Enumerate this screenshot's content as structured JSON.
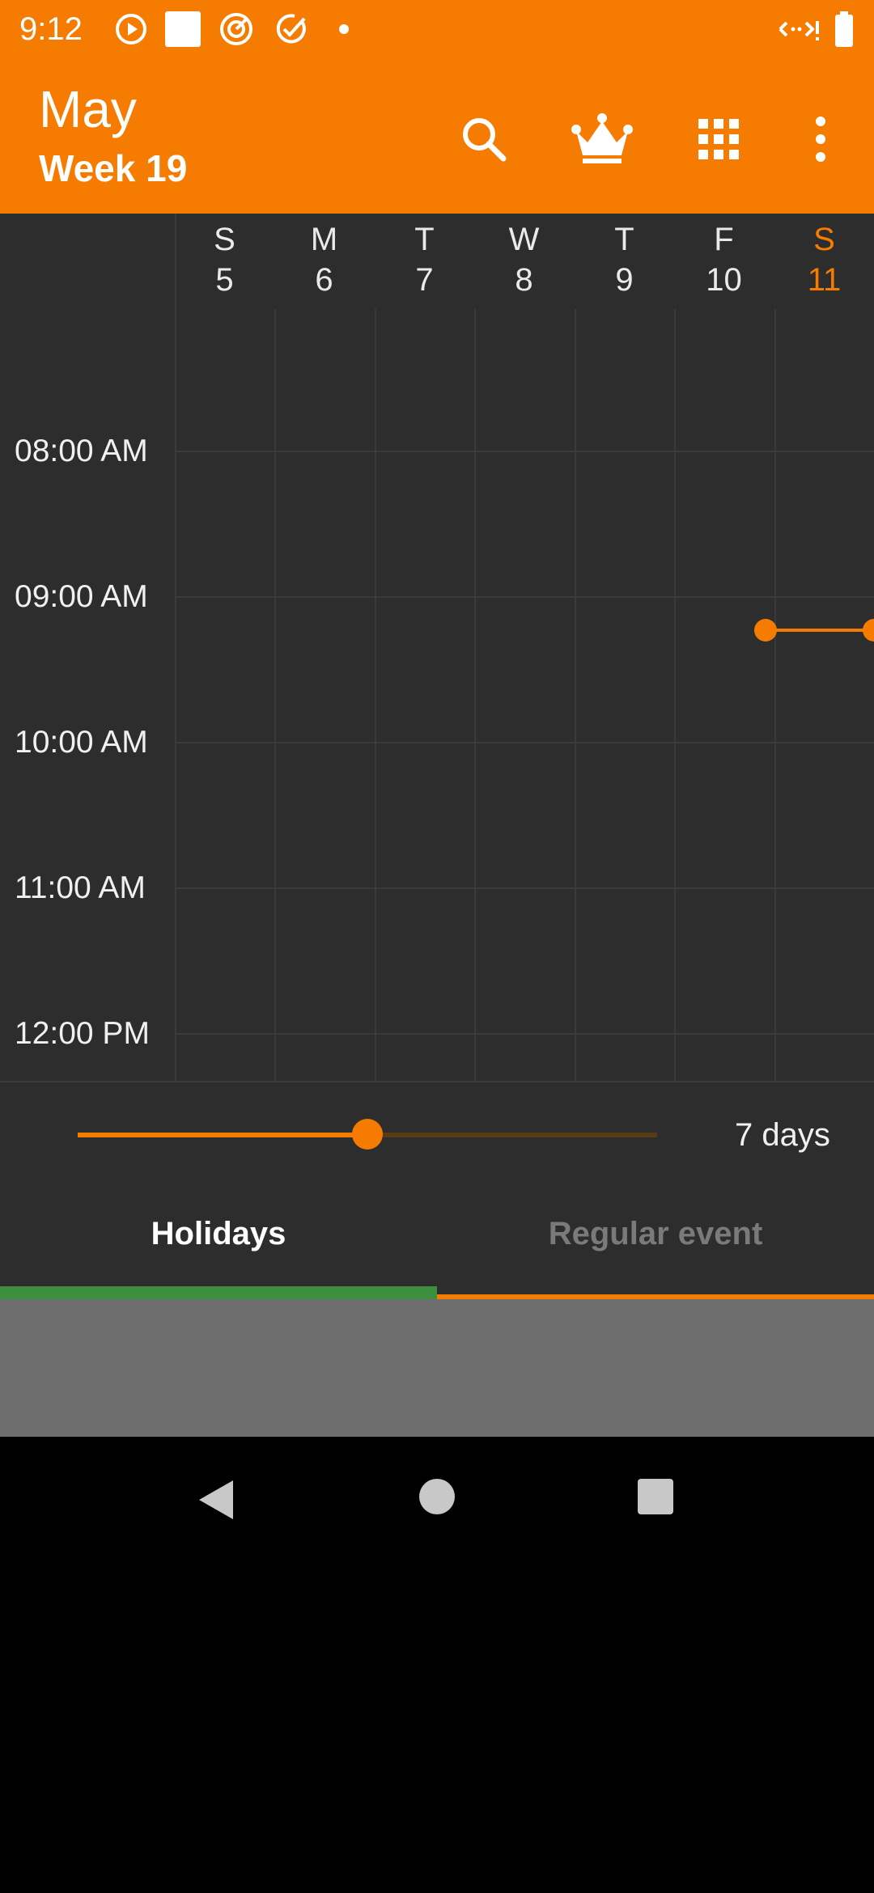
{
  "status_bar": {
    "time": "9:12",
    "icons": [
      "play-circle-icon",
      "square-notification-icon",
      "target-icon",
      "check-badge-icon",
      "dot-icon",
      "data-saver-icon",
      "battery-icon"
    ]
  },
  "app_bar": {
    "title": "May",
    "subtitle": "Week 19",
    "actions": [
      "search-icon",
      "crown-icon",
      "grid-apps-icon",
      "more-vert-icon"
    ]
  },
  "week": {
    "days": [
      {
        "letter": "S",
        "number": "5",
        "today": false
      },
      {
        "letter": "M",
        "number": "6",
        "today": false
      },
      {
        "letter": "T",
        "number": "7",
        "today": false
      },
      {
        "letter": "W",
        "number": "8",
        "today": false
      },
      {
        "letter": "T",
        "number": "9",
        "today": false
      },
      {
        "letter": "F",
        "number": "10",
        "today": false
      },
      {
        "letter": "S",
        "number": "11",
        "today": true
      }
    ]
  },
  "time_labels": [
    "08:00 AM",
    "09:00 AM",
    "10:00 AM",
    "11:00 AM",
    "12:00 PM"
  ],
  "controls": {
    "days_value": "7 days",
    "slider_fraction": 0.5
  },
  "tabs": {
    "holidays": "Holidays",
    "regular": "Regular event"
  },
  "colors": {
    "accent": "#F57C00",
    "background": "#2D2D2D",
    "holiday_indicator": "#3C8F3C"
  }
}
